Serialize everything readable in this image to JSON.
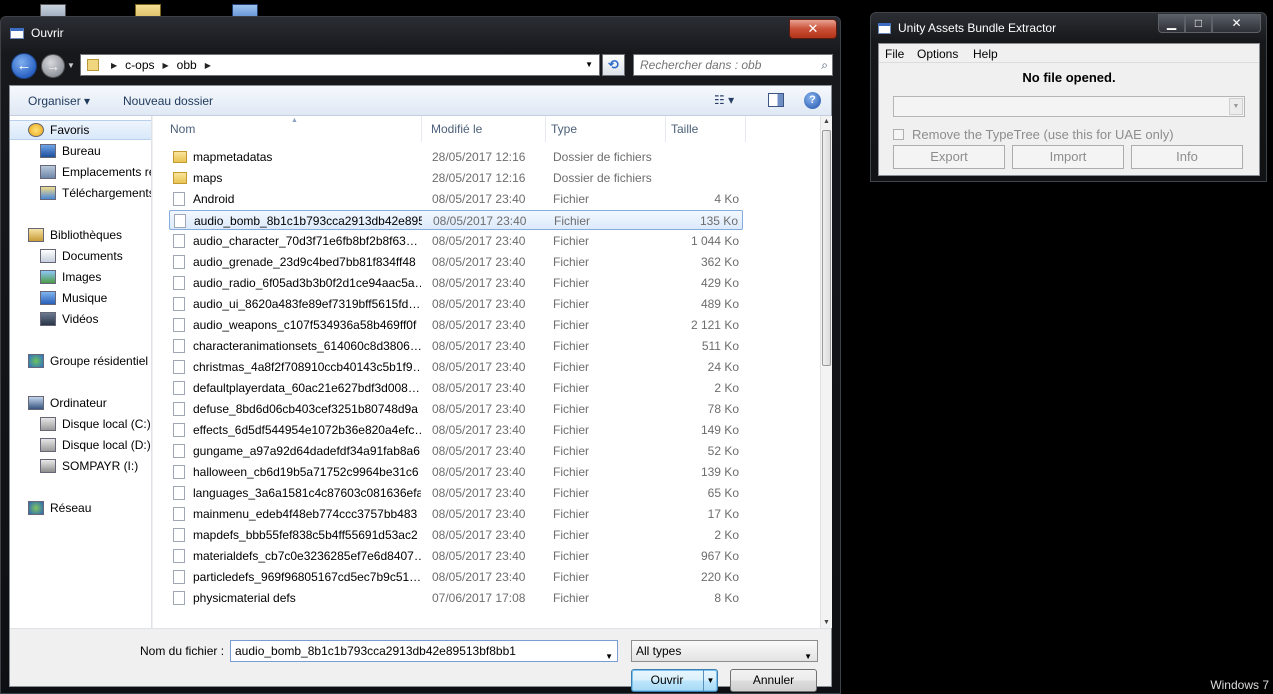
{
  "desktop": {
    "os_watermark": "Windows 7"
  },
  "dialog": {
    "title": "Ouvrir",
    "close_label": "✕",
    "address": {
      "segments": [
        "c-ops",
        "obb"
      ]
    },
    "search_placeholder": "Rechercher dans : obb",
    "toolbar": {
      "organize": "Organiser ▾",
      "new_folder": "Nouveau dossier",
      "help": "?"
    },
    "nav": [
      {
        "label": "Favoris",
        "icon": "star-icon"
      },
      {
        "label": "Bureau",
        "icon": "desktop-icon"
      },
      {
        "label": "Emplacements récents",
        "icon": "recent-places-icon"
      },
      {
        "label": "Téléchargements",
        "icon": "downloads-icon"
      },
      {
        "label": "Bibliothèques",
        "icon": "libraries-icon"
      },
      {
        "label": "Documents",
        "icon": "documents-icon"
      },
      {
        "label": "Images",
        "icon": "pictures-icon"
      },
      {
        "label": "Musique",
        "icon": "music-icon"
      },
      {
        "label": "Vidéos",
        "icon": "videos-icon"
      },
      {
        "label": "Groupe résidentiel",
        "icon": "homegroup-icon"
      },
      {
        "label": "Ordinateur",
        "icon": "computer-icon"
      },
      {
        "label": "Disque local (C:)",
        "icon": "drive-icon"
      },
      {
        "label": "Disque local (D:)",
        "icon": "drive-icon"
      },
      {
        "label": "SOMPAYR (I:)",
        "icon": "usb-drive-icon"
      },
      {
        "label": "Réseau",
        "icon": "network-icon"
      }
    ],
    "columns": {
      "name": "Nom",
      "modified": "Modifié le",
      "type": "Type",
      "size": "Taille"
    },
    "files": [
      {
        "name": "mapmetadatas",
        "date": "28/05/2017 12:16",
        "type": "Dossier de fichiers",
        "size": "",
        "kind": "folder"
      },
      {
        "name": "maps",
        "date": "28/05/2017 12:16",
        "type": "Dossier de fichiers",
        "size": "",
        "kind": "folder"
      },
      {
        "name": "Android",
        "date": "08/05/2017 23:40",
        "type": "Fichier",
        "size": "4 Ko",
        "kind": "file"
      },
      {
        "name": "audio_bomb_8b1c1b793cca2913db42e89513bf8bb1",
        "date": "08/05/2017 23:40",
        "type": "Fichier",
        "size": "135 Ko",
        "kind": "file"
      },
      {
        "name": "audio_character_70d3f71e6fb8bf2b8f638a",
        "date": "08/05/2017 23:40",
        "type": "Fichier",
        "size": "1 044 Ko",
        "kind": "file"
      },
      {
        "name": "audio_grenade_23d9c4bed7bb81f834ff48",
        "date": "08/05/2017 23:40",
        "type": "Fichier",
        "size": "362 Ko",
        "kind": "file"
      },
      {
        "name": "audio_radio_6f05ad3b3b0f2d1ce94aac5ae",
        "date": "08/05/2017 23:40",
        "type": "Fichier",
        "size": "429 Ko",
        "kind": "file"
      },
      {
        "name": "audio_ui_8620a483fe89ef7319bff5615fd85",
        "date": "08/05/2017 23:40",
        "type": "Fichier",
        "size": "489 Ko",
        "kind": "file"
      },
      {
        "name": "audio_weapons_c107f534936a58b469ff0f",
        "date": "08/05/2017 23:40",
        "type": "Fichier",
        "size": "2 121 Ko",
        "kind": "file"
      },
      {
        "name": "characteranimationsets_614060c8d3806c",
        "date": "08/05/2017 23:40",
        "type": "Fichier",
        "size": "511 Ko",
        "kind": "file"
      },
      {
        "name": "christmas_4a8f2f708910ccb40143c5b1f9f",
        "date": "08/05/2017 23:40",
        "type": "Fichier",
        "size": "24 Ko",
        "kind": "file"
      },
      {
        "name": "defaultplayerdata_60ac21e627bdf3d0088",
        "date": "08/05/2017 23:40",
        "type": "Fichier",
        "size": "2 Ko",
        "kind": "file"
      },
      {
        "name": "defuse_8bd6d06cb403cef3251b80748d9a",
        "date": "08/05/2017 23:40",
        "type": "Fichier",
        "size": "78 Ko",
        "kind": "file"
      },
      {
        "name": "effects_6d5df544954e1072b36e820a4efc2",
        "date": "08/05/2017 23:40",
        "type": "Fichier",
        "size": "149 Ko",
        "kind": "file"
      },
      {
        "name": "gungame_a97a92d64dadefdf34a91fab8a6",
        "date": "08/05/2017 23:40",
        "type": "Fichier",
        "size": "52 Ko",
        "kind": "file"
      },
      {
        "name": "halloween_cb6d19b5a71752c9964be31c6",
        "date": "08/05/2017 23:40",
        "type": "Fichier",
        "size": "139 Ko",
        "kind": "file"
      },
      {
        "name": "languages_3a6a1581c4c87603c081636efa",
        "date": "08/05/2017 23:40",
        "type": "Fichier",
        "size": "65 Ko",
        "kind": "file"
      },
      {
        "name": "mainmenu_edeb4f48eb774ccc3757bb483",
        "date": "08/05/2017 23:40",
        "type": "Fichier",
        "size": "17 Ko",
        "kind": "file"
      },
      {
        "name": "mapdefs_bbb55fef838c5b4ff55691d53ac2",
        "date": "08/05/2017 23:40",
        "type": "Fichier",
        "size": "2 Ko",
        "kind": "file"
      },
      {
        "name": "materialdefs_cb7c0e3236285ef7e6d8407f",
        "date": "08/05/2017 23:40",
        "type": "Fichier",
        "size": "967 Ko",
        "kind": "file"
      },
      {
        "name": "particledefs_969f96805167cd5ec7b9c51a1",
        "date": "08/05/2017 23:40",
        "type": "Fichier",
        "size": "220 Ko",
        "kind": "file"
      },
      {
        "name": "physicmaterial defs",
        "date": "07/06/2017 17:08",
        "type": "Fichier",
        "size": "8 Ko",
        "kind": "file"
      }
    ],
    "selected_index": 3,
    "filename_label": "Nom du fichier :",
    "filename_value": "audio_bomb_8b1c1b793cca2913db42e89513bf8bb1",
    "filetype_value": "All types",
    "open_label": "Ouvrir",
    "cancel_label": "Annuler"
  },
  "uabe": {
    "title": "Unity Assets Bundle Extractor",
    "menu": [
      "File",
      "Options",
      "Help"
    ],
    "status": "No file opened.",
    "checkbox_label": "Remove the TypeTree (use this for UAE only)",
    "buttons": {
      "export": "Export",
      "import": "Import",
      "info": "Info"
    },
    "window_buttons": {
      "minimize": "▁",
      "maximize": "□",
      "close": "✕"
    }
  }
}
